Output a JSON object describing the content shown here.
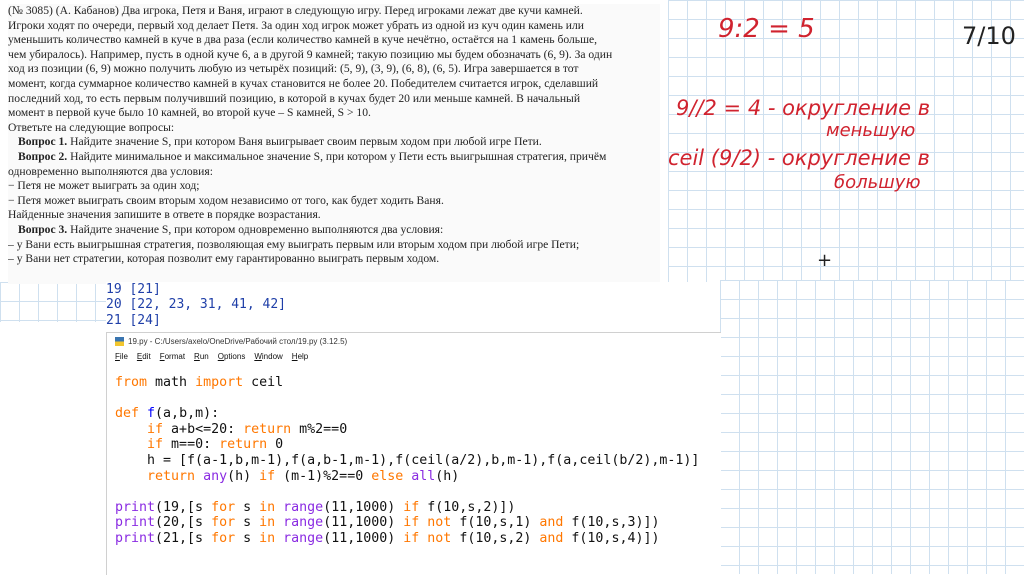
{
  "problem": {
    "lines": [
      "(№ 3085) (А. Кабанов) Два игрока, Петя и Ваня, играют в следующую игру. Перед игроками лежат две кучи камней.",
      "Игроки ходят по очереди, первый ход делает Петя. За один ход игрок может убрать из одной из куч один камень или",
      "уменьшить количество камней в куче в два раза (если количество камней в куче нечётно, остаётся на 1 камень больше,",
      "чем убиралось). Например, пусть в одной куче 6, а в другой 9 камней; такую позицию мы будем обозначать (6, 9). За один",
      "ход из позиции (6, 9) можно получить любую из четырёх позиций: (5, 9), (3, 9), (6, 8), (6, 5). Игра завершается в тот",
      "момент, когда суммарное количество камней в кучах становится не более 20. Победителем считается игрок, сделавший",
      "последний ход, то есть первым получивший позицию, в которой в кучах будет 20 или меньше камней. В начальный",
      "момент в первой куче было 10 камней, во второй куче – S камней, S > 10.",
      "Ответьте на следующие вопросы:"
    ],
    "q1_label": "Вопрос 1.",
    "q1_text": " Найдите значение S, при котором Ваня выигрывает своим первым ходом при любой игре Пети.",
    "q2_label": "Вопрос 2.",
    "q2_text": " Найдите минимальное и максимальное значение S, при котором у Пети есть выигрышная стратегия, причём",
    "q2_lines": [
      "одновременно выполняются два условия:",
      "− Петя не может выиграть за один ход;",
      "− Петя может выиграть своим вторым ходом независимо от того, как будет ходить Ваня.",
      "Найденные значения запишите в ответе в порядке возрастания."
    ],
    "q3_label": "Вопрос 3.",
    "q3_text": " Найдите значение S, при котором одновременно выполняются два условия:",
    "q3_lines": [
      "– у Вани есть выигрышная стратегия, позволяющая ему выиграть первым или вторым ходом при любой игре Пети;",
      "– у Вани нет стратегии, которая позволит ему гарантированно выиграть первым ходом."
    ]
  },
  "notes": {
    "n1": "9:2 = 5",
    "n2": "7/10",
    "n3": "9//2 = 4 - округление в",
    "n4": "меньшую",
    "n5": "ceil (9/2) - округление в",
    "n6": "большую",
    "cursor": "+"
  },
  "output": [
    "19 [21]",
    "20 [22, 23, 31, 41, 42]",
    "21 [24]"
  ],
  "editor": {
    "title": "19.py - C:/Users/axelo/OneDrive/Рабочий стол/19.py (3.12.5)",
    "menu": [
      "File",
      "Edit",
      "Format",
      "Run",
      "Options",
      "Window",
      "Help"
    ],
    "code": {
      "l1_kw1": "from",
      "l1_a": " math ",
      "l1_kw2": "import",
      "l1_b": " ceil",
      "l2_kw": "def",
      "l2_fn": " f",
      "l2_rest": "(a,b,m):",
      "l3_kw1": "    if",
      "l3_a": " a+b<=20: ",
      "l3_kw2": "return",
      "l3_b": " m%2==0",
      "l4_kw1": "    if",
      "l4_a": " m==0: ",
      "l4_kw2": "return",
      "l4_b": " 0",
      "l5": "    h = [f(a-1,b,m-1),f(a,b-1,m-1),f(ceil(a/2),b,m-1),f(a,ceil(b/2),m-1)]",
      "l6_kw1": "    return",
      "l6_bi1": " any",
      "l6_a": "(h) ",
      "l6_kw2": "if",
      "l6_b": " (m-1)%2==0 ",
      "l6_kw3": "else",
      "l6_bi2": " all",
      "l6_c": "(h)",
      "p1_bi": "print",
      "p1_a": "(19,[s ",
      "p1_kw1": "for",
      "p1_b": " s ",
      "p1_kw2": "in",
      "p1_bi2": " range",
      "p1_c": "(11,1000) ",
      "p1_kw3": "if",
      "p1_d": " f(10,s,2)])",
      "p2_bi": "print",
      "p2_a": "(20,[s ",
      "p2_kw1": "for",
      "p2_b": " s ",
      "p2_kw2": "in",
      "p2_bi2": " range",
      "p2_c": "(11,1000) ",
      "p2_kw3": "if not",
      "p2_d": " f(10,s,1) ",
      "p2_kw4": "and",
      "p2_e": " f(10,s,3)])",
      "p3_bi": "print",
      "p3_a": "(21,[s ",
      "p3_kw1": "for",
      "p3_b": " s ",
      "p3_kw2": "in",
      "p3_bi2": " range",
      "p3_c": "(11,1000) ",
      "p3_kw3": "if not",
      "p3_d": " f(10,s,2) ",
      "p3_kw4": "and",
      "p3_e": " f(10,s,4)])"
    }
  }
}
